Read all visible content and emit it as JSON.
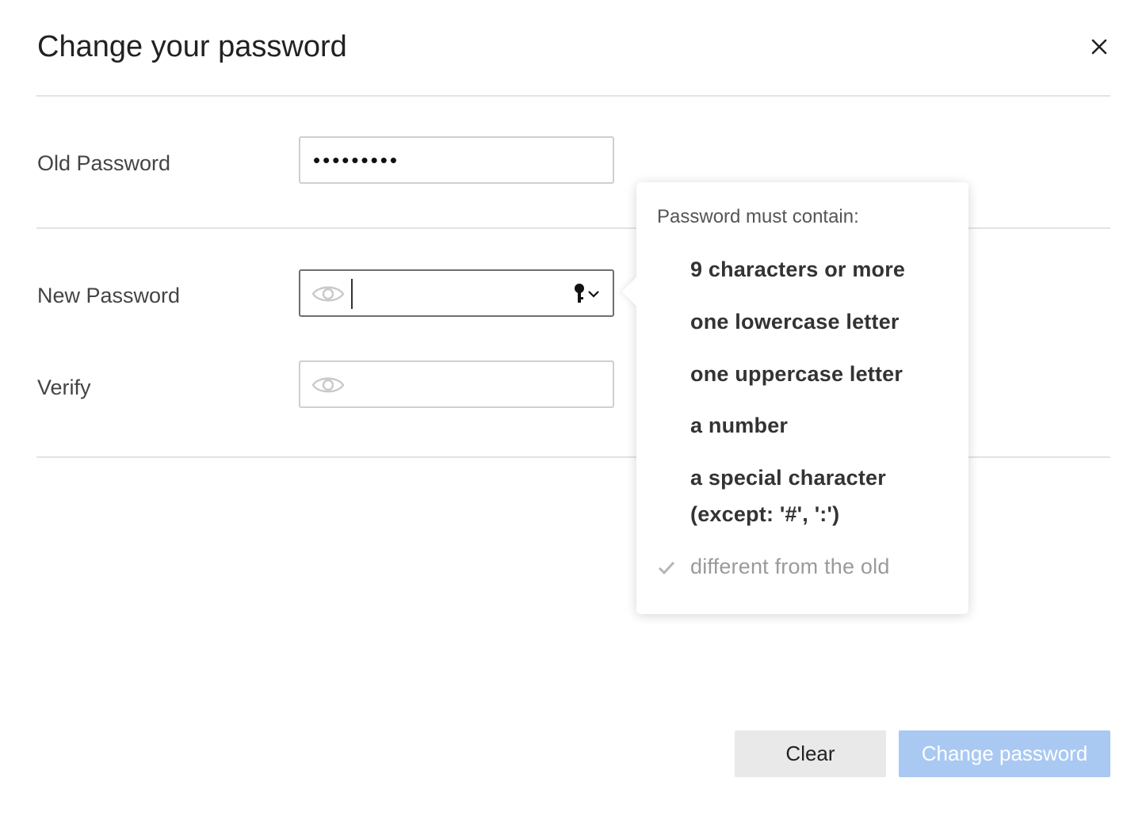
{
  "dialog": {
    "title": "Change your password",
    "close_label": "×"
  },
  "form": {
    "old_password": {
      "label": "Old Password",
      "masked_value": "•••••••••"
    },
    "new_password": {
      "label": "New Password",
      "value": ""
    },
    "verify": {
      "label": "Verify",
      "value": ""
    }
  },
  "requirements": {
    "heading": "Password must contain:",
    "items": [
      {
        "text": "9 characters or more",
        "met": false
      },
      {
        "text": "one lowercase letter",
        "met": false
      },
      {
        "text": "one uppercase letter",
        "met": false
      },
      {
        "text": "a number",
        "met": false
      },
      {
        "text": "a special character",
        "met": false
      },
      {
        "text": "(except: '#', ':')",
        "met": false
      },
      {
        "text": "different from the old",
        "met": true
      }
    ]
  },
  "buttons": {
    "clear": "Clear",
    "change": "Change password"
  },
  "colors": {
    "primary_disabled": "#a9c9f2",
    "secondary_bg": "#e9e9e9",
    "divider": "#e3e3e3"
  },
  "icons": {
    "eye": "eye-icon",
    "key": "key-icon",
    "chevron": "chevron-down-icon",
    "check": "check-icon",
    "close": "close-icon"
  }
}
